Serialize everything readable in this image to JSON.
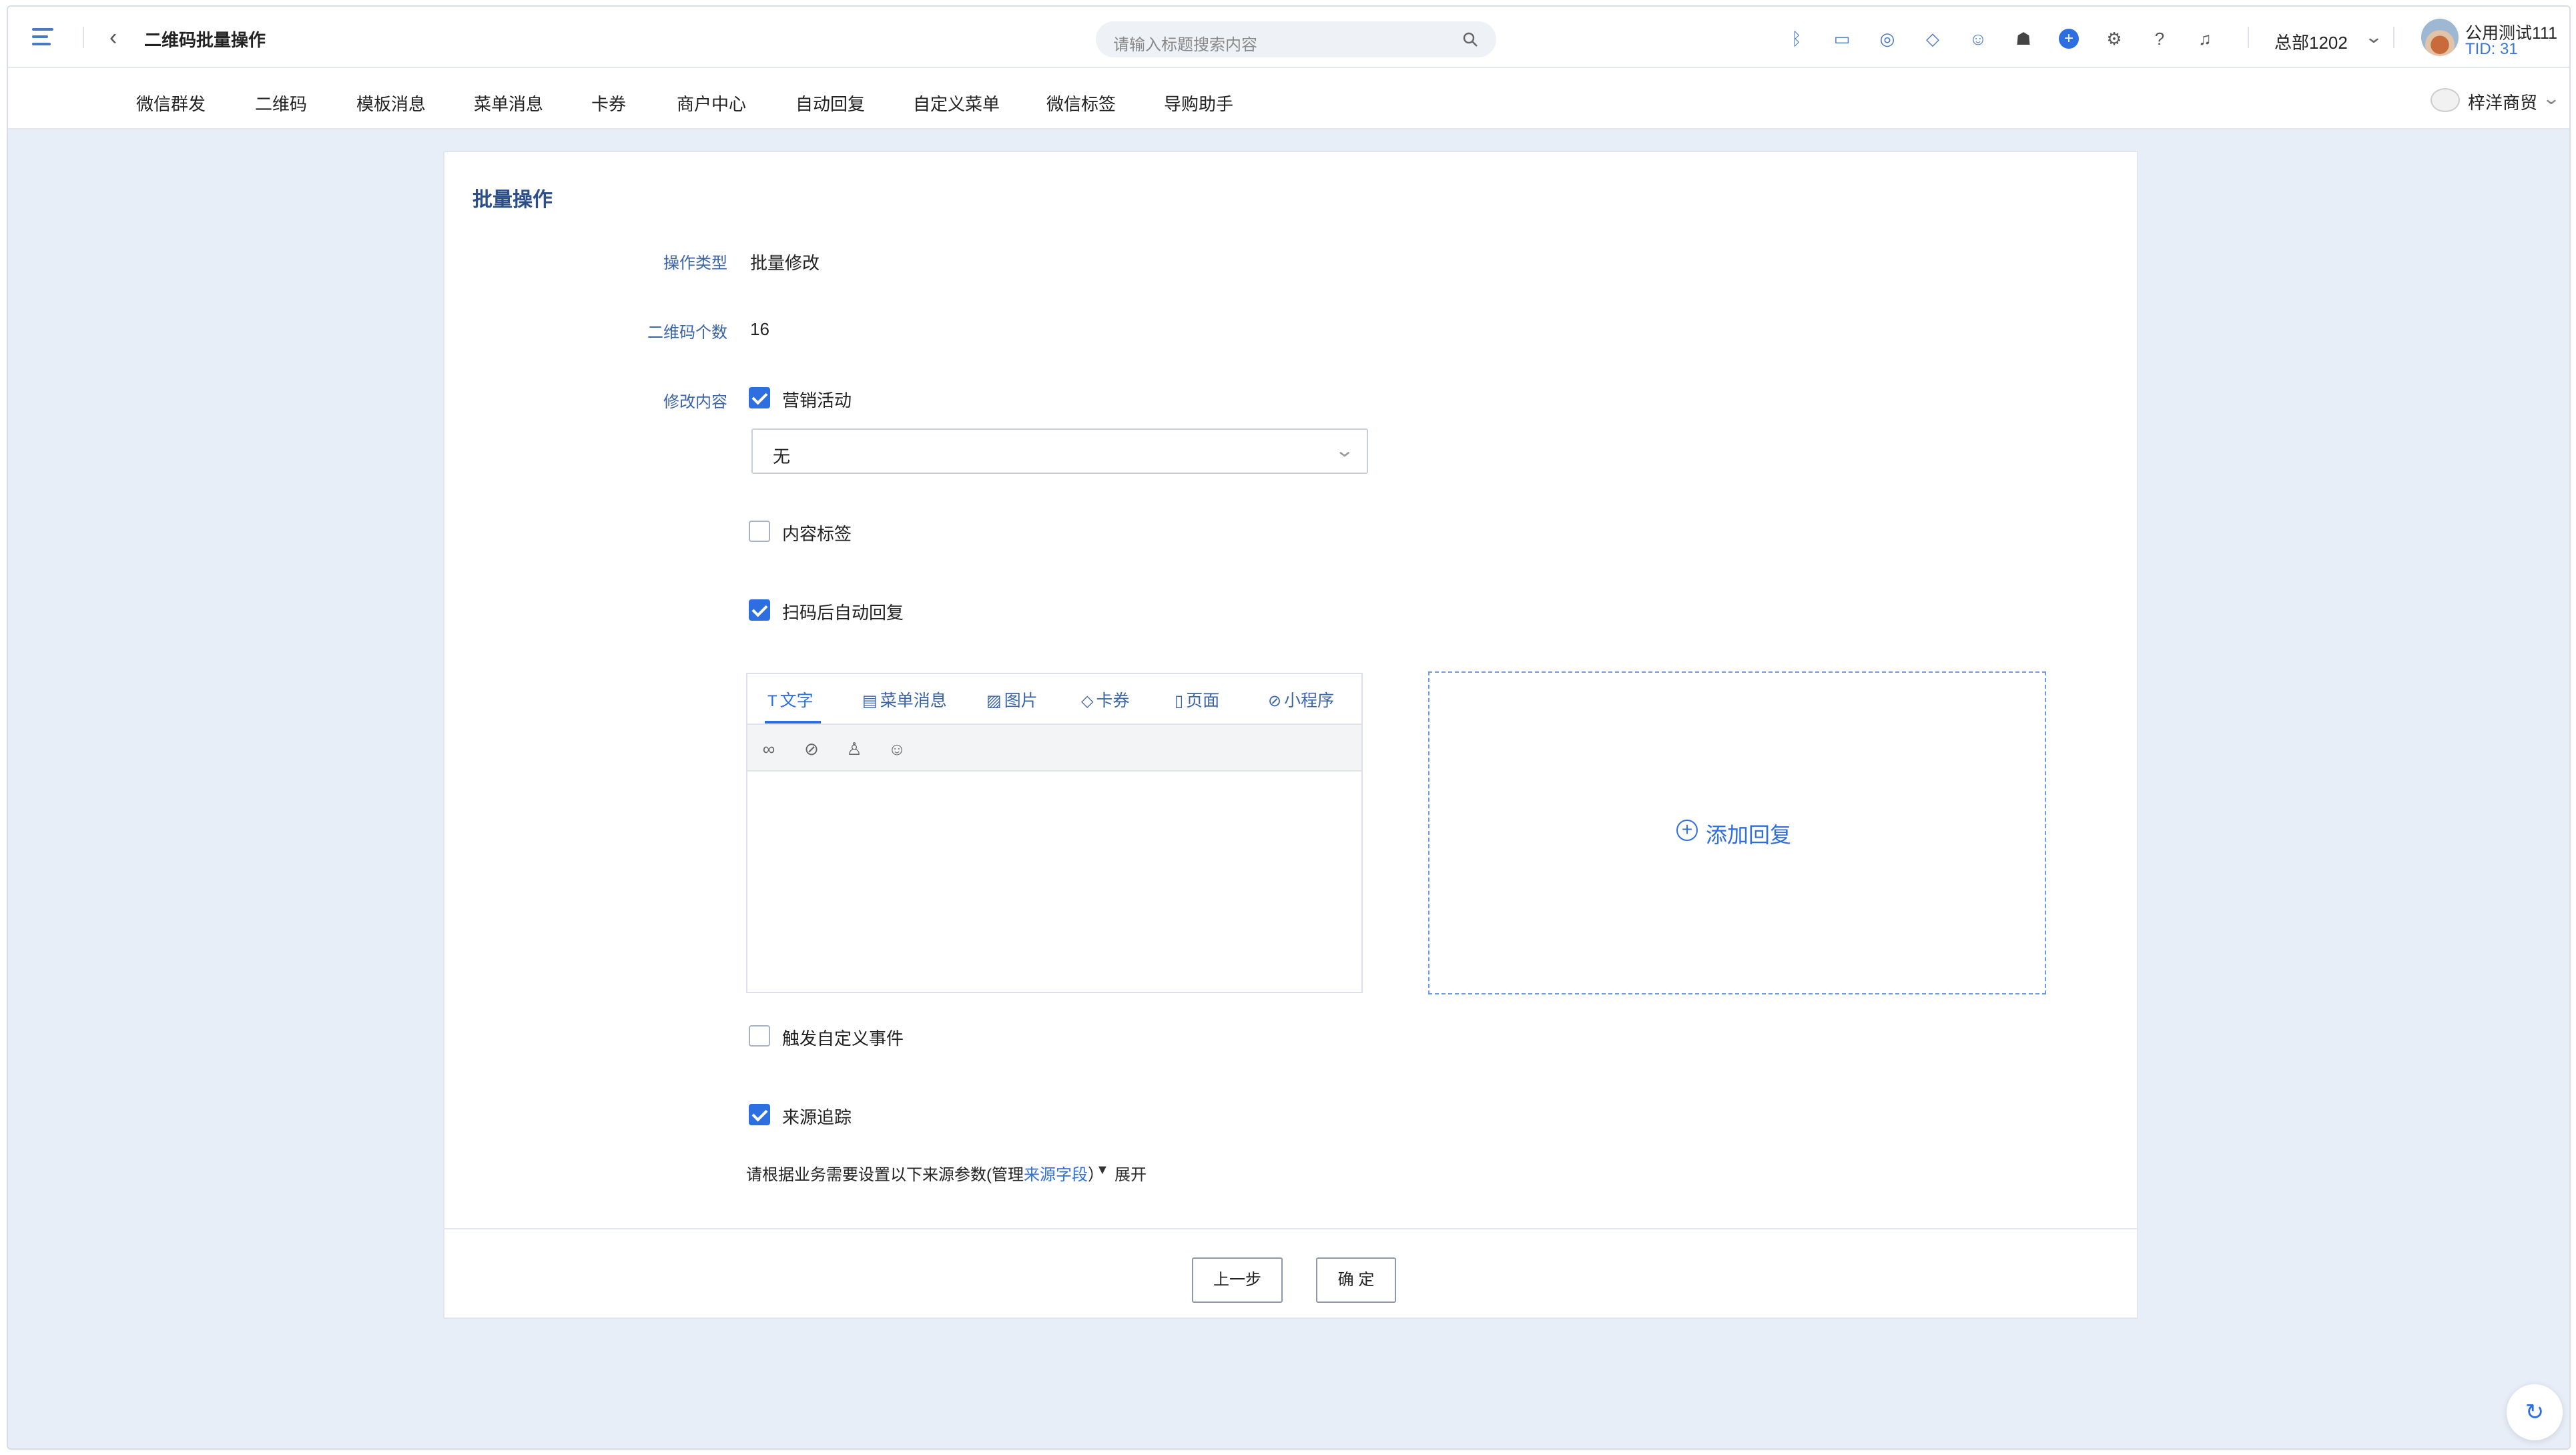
{
  "header": {
    "page_title": "二维码批量操作",
    "search_placeholder": "请输入标题搜索内容",
    "store_name": "总部1202",
    "user_name": "公用测试111",
    "user_tid": "TID: 31"
  },
  "nav": {
    "items": [
      "微信群发",
      "二维码",
      "模板消息",
      "菜单消息",
      "卡券",
      "商户中心",
      "自动回复",
      "自定义菜单",
      "微信标签",
      "导购助手"
    ],
    "brand_name": "梓洋商贸"
  },
  "card": {
    "title": "批量操作",
    "fields": {
      "op_type_label": "操作类型",
      "op_type_value": "批量修改",
      "count_label": "二维码个数",
      "count_value": "16",
      "content_label": "修改内容"
    },
    "options": {
      "marketing": "营销活动",
      "marketing_select": "无",
      "content_tag": "内容标签",
      "auto_reply": "扫码后自动回复",
      "custom_event": "触发自定义事件",
      "source_tracking": "来源追踪"
    },
    "checked": {
      "marketing": true,
      "content_tag": false,
      "auto_reply": true,
      "custom_event": false,
      "source_tracking": true
    },
    "editor_tabs": [
      "文字",
      "菜单消息",
      "图片",
      "卡券",
      "页面",
      "小程序"
    ],
    "active_tab": "文字",
    "add_reply": "添加回复",
    "hint_prefix": "请根据业务需要设置以下来源参数(管理",
    "hint_link": "来源字段",
    "hint_suffix": "）",
    "expand": "展开",
    "buttons": {
      "prev": "上一步",
      "confirm": "确 定"
    }
  }
}
